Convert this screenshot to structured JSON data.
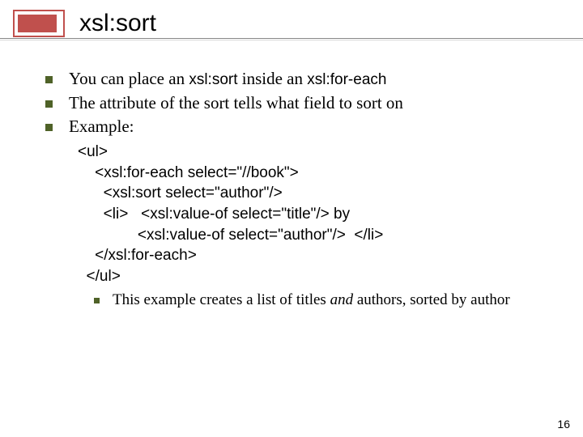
{
  "title": "xsl:sort",
  "bullets": [
    {
      "pre": "You can place an ",
      "code1": "xsl:sort",
      "mid": " inside an ",
      "code2": "xsl:for-each"
    },
    {
      "text": "The attribute of the sort tells what field to sort on"
    },
    {
      "text": "Example:"
    }
  ],
  "code": {
    "l1": "<ul>",
    "l2": "    <xsl:for-each select=\"//book\">",
    "l3": "      <xsl:sort select=\"author\"/>",
    "l4": "      <li>   <xsl:value-of select=\"title\"/> by",
    "l5": "              <xsl:value-of select=\"author\"/>  </li>",
    "l6": "    </xsl:for-each>",
    "l7": "  </ul>"
  },
  "sub": {
    "pre": "This example creates a list of titles ",
    "em": "and",
    "post": " authors, sorted by author"
  },
  "pagenum": "16"
}
